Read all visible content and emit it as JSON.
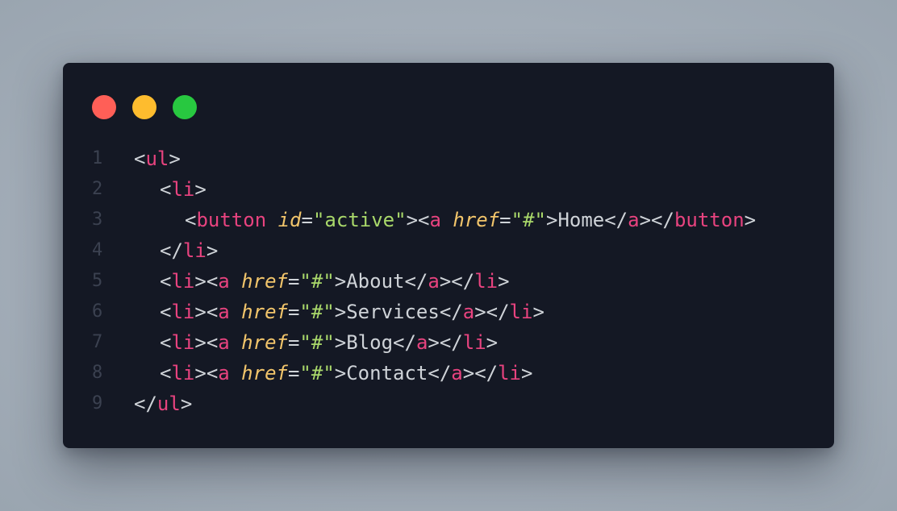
{
  "colors": {
    "background": "#a9b3bd",
    "window": "#141824",
    "dot_red": "#ff5f57",
    "dot_yellow": "#febc2e",
    "dot_green": "#28c840",
    "tag": "#e8437f",
    "attr": "#f2c56b",
    "string": "#a9d86a",
    "punct": "#cfd3d8",
    "line_number": "#3b4150"
  },
  "window_controls": [
    {
      "name": "close-dot",
      "icon": "red-circle-icon"
    },
    {
      "name": "minimize-dot",
      "icon": "yellow-circle-icon"
    },
    {
      "name": "maximize-dot",
      "icon": "green-circle-icon"
    }
  ],
  "code": {
    "line_numbers": [
      "1",
      "2",
      "3",
      "4",
      "5",
      "6",
      "7",
      "8",
      "9"
    ],
    "tokens": {
      "ul": "ul",
      "li": "li",
      "button": "button",
      "a": "a",
      "id": "id",
      "href": "href",
      "active_val": "\"active\"",
      "hash_val": "\"#\"",
      "lt": "<",
      "gt": ">",
      "lt_slash": "</",
      "eq": "=",
      "space": " "
    },
    "texts": {
      "home": "Home",
      "about": "About",
      "services": "Services",
      "blog": "Blog",
      "contact": "Contact"
    }
  }
}
